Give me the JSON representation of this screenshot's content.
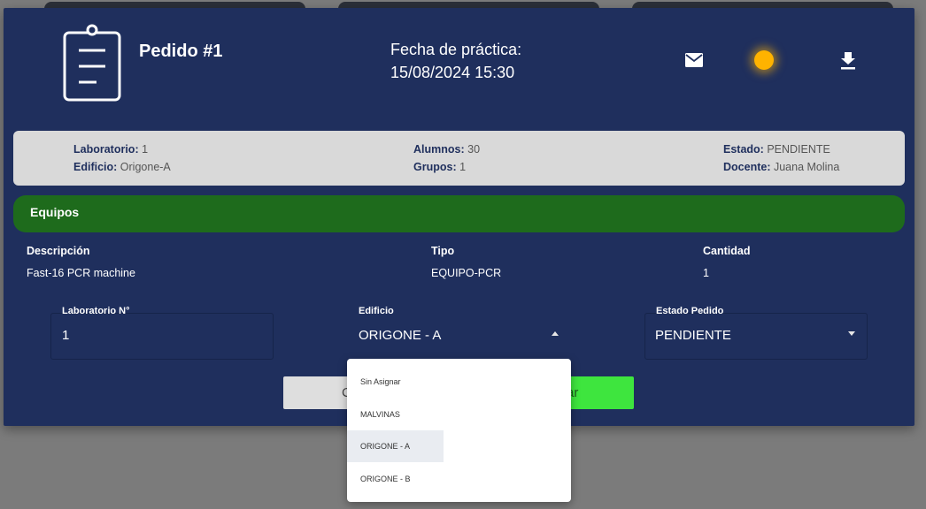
{
  "header": {
    "title": "Pedido #1",
    "date_label": "Fecha de práctica:",
    "date_value": "15/08/2024 15:30",
    "status_color": "#ffb300"
  },
  "info": {
    "laboratorio_label": "Laboratorio:",
    "laboratorio_value": "1",
    "edificio_label": "Edificio:",
    "edificio_value": "Origone-A",
    "alumnos_label": "Alumnos:",
    "alumnos_value": "30",
    "grupos_label": "Grupos:",
    "grupos_value": "1",
    "estado_label": "Estado:",
    "estado_value": "PENDIENTE",
    "docente_label": "Docente:",
    "docente_value": "Juana Molina"
  },
  "equipos": {
    "section_title": "Equipos",
    "columns": [
      "Descripción",
      "Tipo",
      "Cantidad"
    ],
    "rows": [
      [
        "Fast-16 PCR machine",
        "EQUIPO-PCR",
        "1"
      ]
    ]
  },
  "form": {
    "laboratorio_label": "Laboratorio N°",
    "laboratorio_value": "1",
    "edificio_label": "Edificio",
    "edificio_value": "ORIGONE - A",
    "estado_label": "Estado Pedido",
    "estado_value": "PENDIENTE"
  },
  "buttons": {
    "cancel_label": "C",
    "save_label": "ar"
  },
  "dropdown": {
    "options": [
      "Sin Asignar",
      "MALVINAS",
      "ORIGONE - A",
      "ORIGONE - B"
    ],
    "selected": "ORIGONE - A"
  },
  "colors": {
    "modal_bg": "#1f2f5d",
    "equipos_bar": "#1e6b1c",
    "save_button": "#3ee53e"
  }
}
